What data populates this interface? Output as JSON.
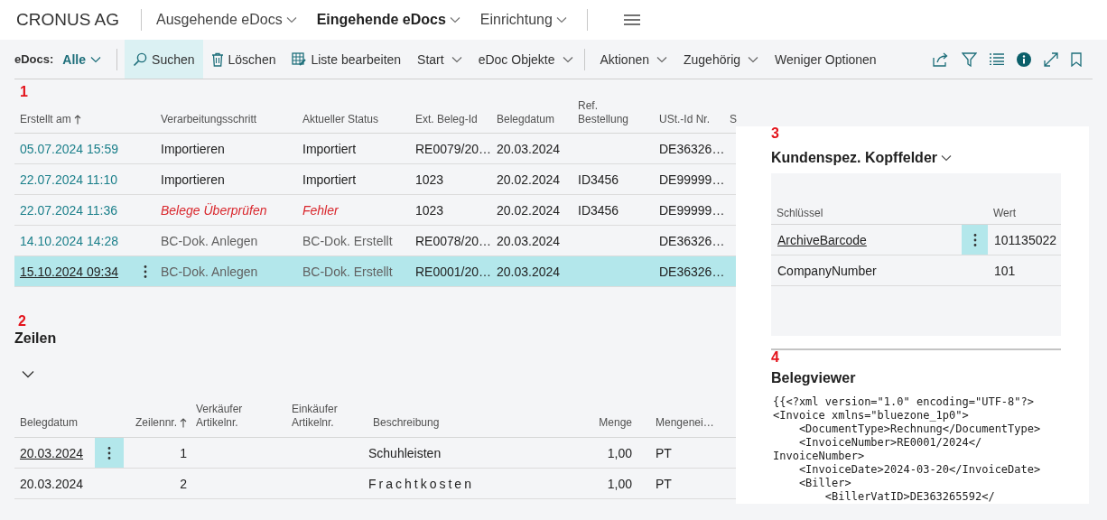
{
  "app_title": "CRONUS AG",
  "nav": [
    {
      "label": "Ausgehende eDocs",
      "selected": false,
      "dropdown": true
    },
    {
      "label": "Eingehende eDocs",
      "selected": true,
      "dropdown": true
    },
    {
      "label": "Einrichtung",
      "selected": false,
      "dropdown": true
    }
  ],
  "filter": {
    "label": "eDocs:",
    "value": "Alle"
  },
  "actions_primary": [
    {
      "label": "Suchen",
      "kind": "search",
      "selected": true
    },
    {
      "label": "Löschen",
      "kind": "delete",
      "selected": false
    },
    {
      "label": "Liste bearbeiten",
      "kind": "edit",
      "selected": false
    },
    {
      "label": "Start",
      "kind": "menu",
      "selected": false
    },
    {
      "label": "eDoc Objekte",
      "kind": "menu",
      "selected": false
    }
  ],
  "actions_secondary": [
    {
      "label": "Aktionen",
      "kind": "menu",
      "selected": false
    },
    {
      "label": "Zugehörig",
      "kind": "menu",
      "selected": false
    },
    {
      "label": "Weniger Optionen",
      "kind": "plain",
      "selected": false
    }
  ],
  "documents": {
    "marker": "1",
    "columns": [
      {
        "label": "Erstellt am",
        "sorted": true
      },
      {
        "label": "Verarbeitungsschritt",
        "sorted": false
      },
      {
        "label": "Aktueller Status",
        "sorted": false
      },
      {
        "label": "Ext. Beleg-Id",
        "sorted": false
      },
      {
        "label": "Belegdatum",
        "sorted": false
      },
      {
        "label": "Ref.\nBestellung",
        "sorted": false
      },
      {
        "label": "USt.-Id Nr.",
        "sorted": false
      },
      {
        "label": "S"
      }
    ],
    "rows": [
      {
        "created": "05.07.2024 15:59",
        "step": "Importieren",
        "status": "Importiert",
        "ext_id": "RE0079/20…",
        "doc_date": "20.03.2024",
        "ref_order": "",
        "vat_id": "DE36326…",
        "kind": "normal",
        "selected": false
      },
      {
        "created": "22.07.2024 11:10",
        "step": "Importieren",
        "status": "Importiert",
        "ext_id": "1023",
        "doc_date": "20.02.2024",
        "ref_order": "ID3456",
        "vat_id": "DE99999…",
        "kind": "normal",
        "selected": false
      },
      {
        "created": "22.07.2024 11:36",
        "step": "Belege Überprüfen",
        "status": "Fehler",
        "ext_id": "1023",
        "doc_date": "20.02.2024",
        "ref_order": "ID3456",
        "vat_id": "DE99999…",
        "kind": "error",
        "selected": false
      },
      {
        "created": "14.10.2024 14:28",
        "step": "BC-Dok. Anlegen",
        "status": "BC-Dok. Erstellt",
        "ext_id": "RE0078/20…",
        "doc_date": "20.03.2024",
        "ref_order": "",
        "vat_id": "DE36326…",
        "kind": "muted",
        "selected": false
      },
      {
        "created": "15.10.2024 09:34",
        "step": "BC-Dok. Anlegen",
        "status": "BC-Dok. Erstellt",
        "ext_id": "RE0001/20…",
        "doc_date": "20.03.2024",
        "ref_order": "",
        "vat_id": "DE36326…",
        "kind": "muted",
        "selected": true
      }
    ]
  },
  "lines": {
    "marker": "2",
    "title": "Zeilen",
    "expanded": true,
    "columns": [
      {
        "label": "Belegdatum",
        "sorted": false
      },
      {
        "label": "Zeilennr.",
        "sorted": true
      },
      {
        "label": "Verkäufer\nArtikelnr.",
        "sorted": false
      },
      {
        "label": "Einkäufer\nArtikelnr.",
        "sorted": false
      },
      {
        "label": "Beschreibung",
        "sorted": false
      },
      {
        "label": "Menge",
        "sorted": false
      },
      {
        "label": "Mengenei…",
        "sorted": false
      }
    ],
    "rows": [
      {
        "doc_date": "20.03.2024",
        "line_no": "1",
        "vendor_item": "",
        "buyer_item": "",
        "description": "Schuhleisten",
        "spaced": false,
        "quantity": "1,00",
        "unit": "PT",
        "selected": true
      },
      {
        "doc_date": "20.03.2024",
        "line_no": "2",
        "vendor_item": "",
        "buyer_item": "",
        "description": "Frachtkosten",
        "spaced": true,
        "quantity": "1,00",
        "unit": "PT",
        "selected": false
      }
    ]
  },
  "custom_fields": {
    "marker": "3",
    "title": "Kundenspez. Kopffelder",
    "columns": [
      "Schlüssel",
      "Wert"
    ],
    "rows": [
      {
        "key": "ArchiveBarcode",
        "value": "101135022",
        "selected": true
      },
      {
        "key": "CompanyNumber",
        "value": "101",
        "selected": false
      }
    ]
  },
  "viewer": {
    "marker": "4",
    "title": "Belegviewer",
    "lines": [
      "{{<?xml version=\"1.0\" encoding=\"UTF-8\"?>",
      "<Invoice xmlns=\"bluezone_1p0\">",
      "    <DocumentType>Rechnung</DocumentType>",
      "    <InvoiceNumber>RE0001/2024</",
      "InvoiceNumber>",
      "    <InvoiceDate>2024-03-20</InvoiceDate>",
      "    <Biller>",
      "        <BillerVatID>DE363265592</"
    ]
  }
}
